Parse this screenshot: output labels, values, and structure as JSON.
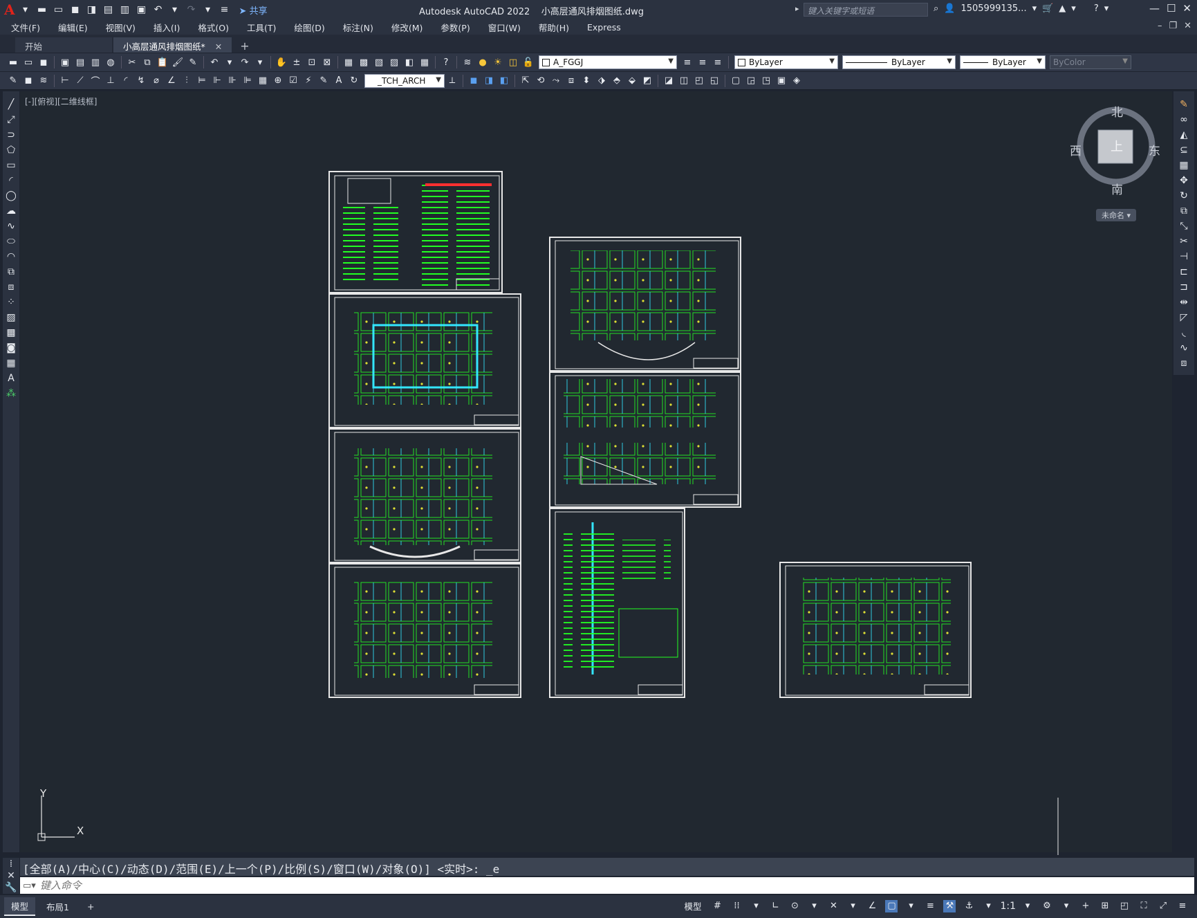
{
  "titlebar": {
    "app": "Autodesk AutoCAD 2022",
    "file": "小高层通风排烟图纸.dwg",
    "share": "共享",
    "search_placeholder": "键入关键字或短语",
    "user": "1505999135..."
  },
  "menu": [
    "文件(F)",
    "编辑(E)",
    "视图(V)",
    "插入(I)",
    "格式(O)",
    "工具(T)",
    "绘图(D)",
    "标注(N)",
    "修改(M)",
    "参数(P)",
    "窗口(W)",
    "帮助(H)",
    "Express"
  ],
  "tabs": [
    {
      "label": "开始"
    },
    {
      "label": "小高层通风排烟图纸*"
    }
  ],
  "toolbar": {
    "layer": "A_FGGJ",
    "color": "ByLayer",
    "linetype": "ByLayer",
    "lineweight": "ByLayer",
    "plotstyle": "ByColor",
    "textstyle": "_TCH_ARCH"
  },
  "viewport_label": "[-][俯视][二维线框]",
  "viewcube": {
    "north": "北",
    "south": "南",
    "east": "东",
    "west": "西",
    "face": "上",
    "ucs": "未命名"
  },
  "ucs_icon": {
    "x": "X",
    "y": "Y"
  },
  "command": {
    "history": "[全部(A)/中心(C)/动态(D)/范围(E)/上一个(P)/比例(S)/窗口(W)/对象(O)] <实时>: _e",
    "placeholder": "键入命令"
  },
  "status": {
    "layout_tabs": [
      "模型",
      "布局1"
    ],
    "model": "模型",
    "scale": "1:1"
  },
  "colors": {
    "background": "#212830",
    "ui": "#2b3240",
    "drawing_green": "#22ff22",
    "drawing_cyan": "#33e6ff",
    "drawing_yellow": "#ffff33",
    "drawing_magenta": "#ff33ff",
    "sheet_border": "#e8e8e8"
  }
}
